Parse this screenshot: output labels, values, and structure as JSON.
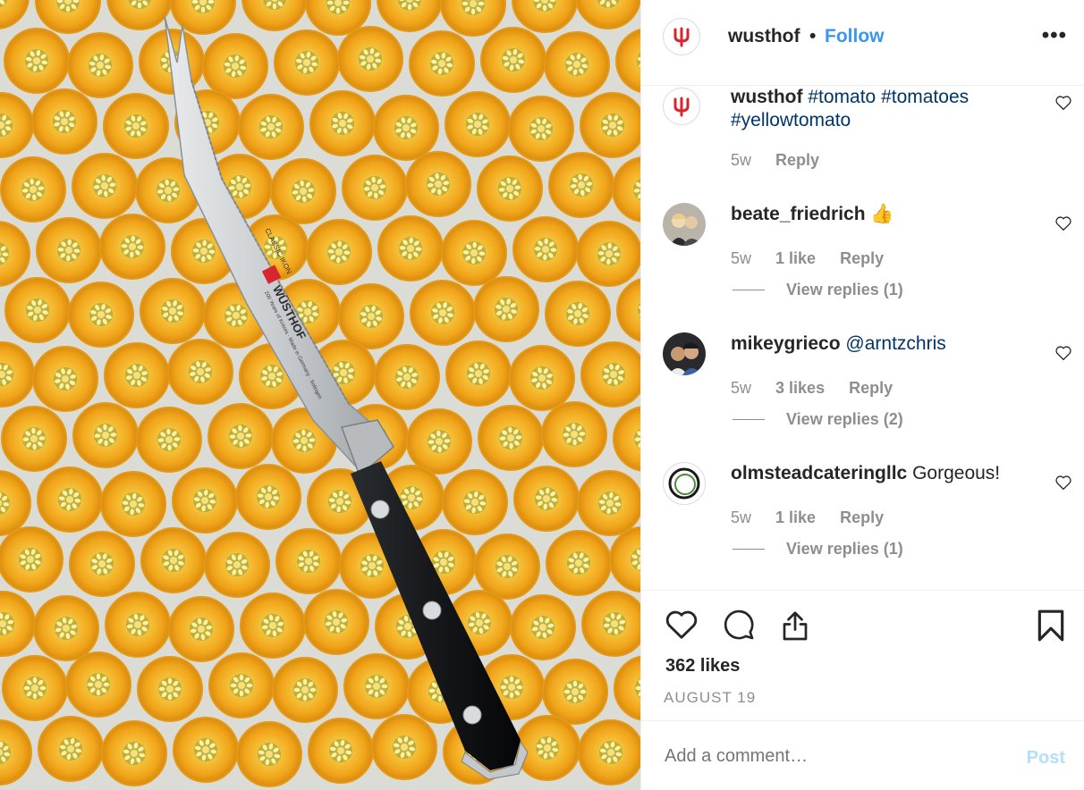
{
  "post": {
    "username": "wusthof",
    "separator": "•",
    "follow_label": "Follow",
    "more_label": "•••",
    "photo": {
      "brand_on_blade": "WÜSTHOF",
      "series_on_blade": "CLASSIC IKON",
      "blade_fine_print": "200 Years of Knives · Made in Germany · Solingen"
    }
  },
  "comments": [
    {
      "user": "wusthof",
      "text_tags": [
        "#tomato",
        "#tomatoes",
        "#yellowtomato"
      ],
      "time": "5w",
      "likes": "",
      "reply": "Reply",
      "view_replies": "",
      "avatar": "brand-logo"
    },
    {
      "user": "beate_friedrich",
      "text": "👍",
      "time": "5w",
      "likes": "1 like",
      "reply": "Reply",
      "view_replies": "View replies (1)",
      "avatar": "photo-two-women"
    },
    {
      "user": "mikeygrieco",
      "mention": "@arntzchris",
      "time": "5w",
      "likes": "3 likes",
      "reply": "Reply",
      "view_replies": "View replies (2)",
      "avatar": "photo-two-men"
    },
    {
      "user": "olmsteadcateringllc",
      "text": "Gorgeous!",
      "time": "5w",
      "likes": "1 like",
      "reply": "Reply",
      "view_replies": "View replies (1)",
      "avatar": "circle-logo"
    }
  ],
  "actions": {
    "like_icon": "heart-outline-icon",
    "comment_icon": "comment-bubble-icon",
    "share_icon": "share-upload-icon",
    "save_icon": "bookmark-icon"
  },
  "likes_count": "362 likes",
  "date": "AUGUST 19",
  "add_comment": {
    "placeholder": "Add a comment…",
    "post_label": "Post"
  },
  "colors": {
    "link": "#3897f0",
    "hashtag": "#003569",
    "muted": "#8e8e8e",
    "brand_red": "#d6262e",
    "tomato": "#f2a11a"
  }
}
